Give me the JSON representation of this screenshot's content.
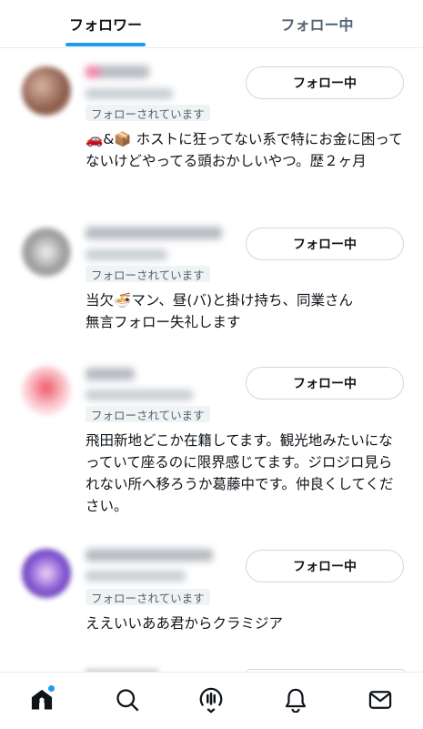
{
  "tabs": [
    {
      "label": "フォロワー",
      "active": true
    },
    {
      "label": "フォロー中",
      "active": false
    }
  ],
  "accent_color": "#1d9bf0",
  "users": [
    {
      "followed_badge": "フォローされています",
      "button_label": "フォロー中",
      "bio_emojis": "🚗&📦",
      "bio": " ホストに狂ってない系で特にお金に困ってないけどやってる頭おかしいやつ。歴２ヶ月"
    },
    {
      "followed_badge": "フォローされています",
      "button_label": "フォロー中",
      "bio_line1_prefix": "当欠",
      "bio_line1_emoji": "🍜",
      "bio_line1_suffix": "マン、昼(バ)と掛け持ち、同業さん",
      "bio_line2": "無言フォロー失礼します"
    },
    {
      "followed_badge": "フォローされています",
      "button_label": "フォロー中",
      "bio": "飛田新地どこか在籍してます。観光地みたいになっていて座るのに限界感じてます。ジロジロ見られない所へ移ろうか葛藤中です。仲良くしてください。"
    },
    {
      "followed_badge": "フォローされています",
      "button_label": "フォロー中",
      "bio": "ええいいああ君からクラミジア"
    }
  ],
  "bottom_nav": [
    {
      "icon": "home-icon",
      "active": true,
      "has_notification_dot": true
    },
    {
      "icon": "search-icon",
      "active": false
    },
    {
      "icon": "spaces-icon",
      "active": false
    },
    {
      "icon": "notifications-icon",
      "active": false
    },
    {
      "icon": "messages-icon",
      "active": false
    }
  ]
}
